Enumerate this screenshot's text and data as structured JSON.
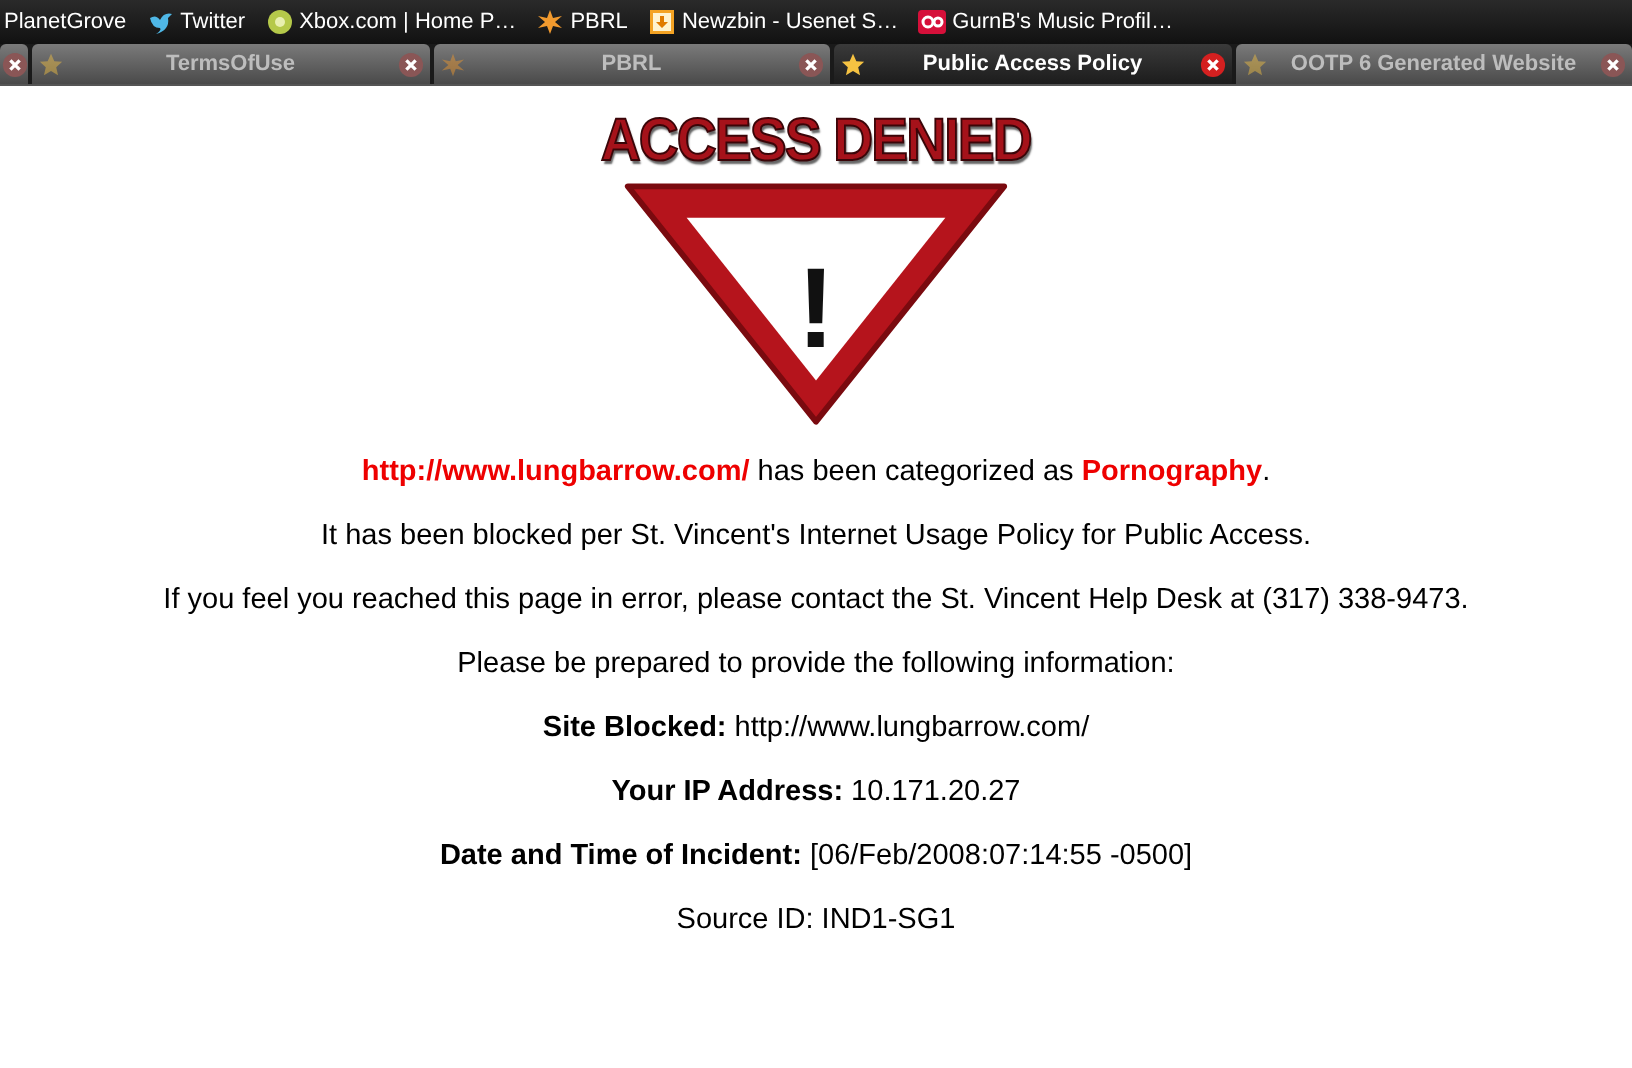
{
  "bookmarks": [
    {
      "label": "PlanetGrove"
    },
    {
      "label": "Twitter"
    },
    {
      "label": "Xbox.com | Home P…"
    },
    {
      "label": "PBRL"
    },
    {
      "label": "Newzbin - Usenet S…"
    },
    {
      "label": "GurnB's Music Profil…"
    }
  ],
  "tabs": [
    {
      "label": "TermsOfUse",
      "selected": false
    },
    {
      "label": "PBRL",
      "selected": false
    },
    {
      "label": "Public Access Policy",
      "selected": true
    },
    {
      "label": "OOTP 6 Generated Website",
      "selected": false
    }
  ],
  "page": {
    "heading": "ACCESS DENIED",
    "sign_mark": "!",
    "category_line": {
      "url": "http://www.lungbarrow.com/",
      "text": "has been categorized as",
      "category": "Pornography",
      "end": "."
    },
    "lines": [
      {
        "kind": "plain",
        "text": "It has been blocked per St. Vincent's Internet Usage Policy for Public Access."
      },
      {
        "kind": "plain",
        "text": "If you feel you reached this page in error, please contact the St. Vincent Help Desk at (317) 338-9473."
      },
      {
        "kind": "plain",
        "text": "Please be prepared to provide the following information:"
      },
      {
        "kind": "field",
        "label": "Site Blocked:",
        "value": "http://www.lungbarrow.com/"
      },
      {
        "kind": "field",
        "label": "Your IP Address:",
        "value": "10.171.20.27"
      },
      {
        "kind": "field",
        "label": "Date and Time of Incident:",
        "value": "[06/Feb/2008:07:14:55 -0500]"
      },
      {
        "kind": "plain",
        "text": "Source ID: IND1-SG1"
      }
    ]
  }
}
